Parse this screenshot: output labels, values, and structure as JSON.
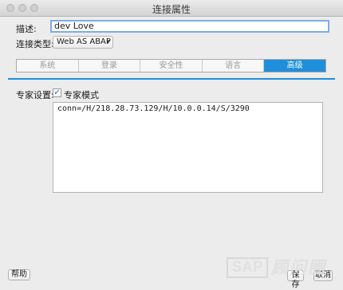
{
  "window": {
    "title": "连接属性"
  },
  "form": {
    "description_label": "描述:",
    "description_value": "dev Love",
    "conn_type_label": "连接类型:",
    "conn_type_value": "Web AS ABAP"
  },
  "tabs": [
    {
      "label": "系统",
      "active": false
    },
    {
      "label": "登录",
      "active": false
    },
    {
      "label": "安全性",
      "active": false
    },
    {
      "label": "语言",
      "active": false
    },
    {
      "label": "高级",
      "active": true
    }
  ],
  "expert": {
    "label": "专家设置:",
    "checkbox_label": "专家模式",
    "checked": true,
    "conn_string": "conn=/H/218.28.73.129/H/10.0.0.14/S/3290"
  },
  "buttons": {
    "help": "帮助",
    "save": "保存",
    "cancel": "取消"
  },
  "watermark": {
    "logo": "SAP",
    "text": "顾问圈"
  },
  "colors": {
    "accent": "#1f8fdb"
  }
}
